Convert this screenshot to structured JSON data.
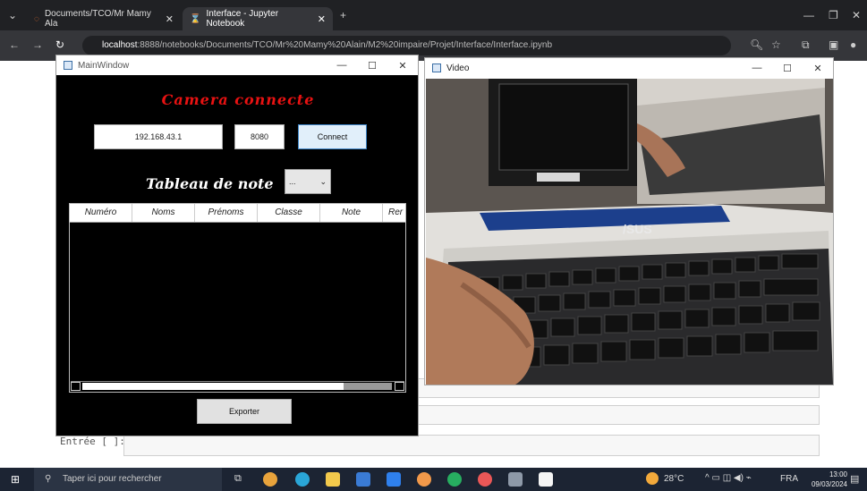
{
  "browser": {
    "tabs": [
      {
        "label": "Documents/TCO/Mr Mamy Ala"
      },
      {
        "label": "Interface - Jupyter Notebook"
      }
    ],
    "url_host": "localhost",
    "url_rest": ":8888/notebooks/Documents/TCO/Mr%20Mamy%20Alain/M2%20impaire/Projet/Interface/Interface.ipynb"
  },
  "notebook": {
    "prompt": "Entrée [ ]:"
  },
  "main_window": {
    "title": "MainWindow",
    "camera_title": "Camera connecte",
    "ip_value": "192.168.43.1",
    "port_value": "8080",
    "connect_label": "Connect",
    "table_title": "Tableau de note",
    "combo_value": "...",
    "columns": [
      "Numéro",
      "Noms",
      "Prénoms",
      "Classe",
      "Note",
      "Rer"
    ],
    "export_label": "Exporter"
  },
  "video_window": {
    "title": "Video",
    "brand": "/SUS"
  },
  "taskbar": {
    "search_placeholder": "Taper ici pour rechercher",
    "weather": "28°C",
    "lang": "FRA",
    "time": "13:00",
    "date": "09/03/2024"
  },
  "colors": {
    "accent": "#3c83c5",
    "camera_title": "#e81212"
  }
}
